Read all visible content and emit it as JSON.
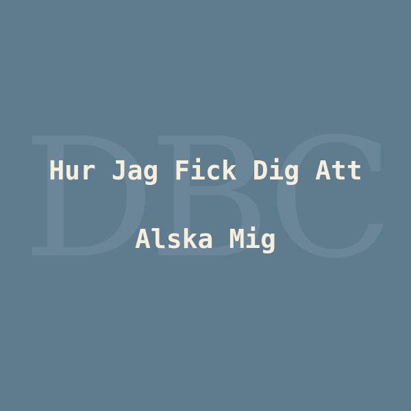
{
  "cover": {
    "watermark": "DBC",
    "title_line1": "Hur Jag Fick Dig Att",
    "title_line2": "Alska Mig"
  },
  "colors": {
    "background": "#5f7b8e",
    "watermark": "#6b8698",
    "title_text": "#f7efdc"
  }
}
